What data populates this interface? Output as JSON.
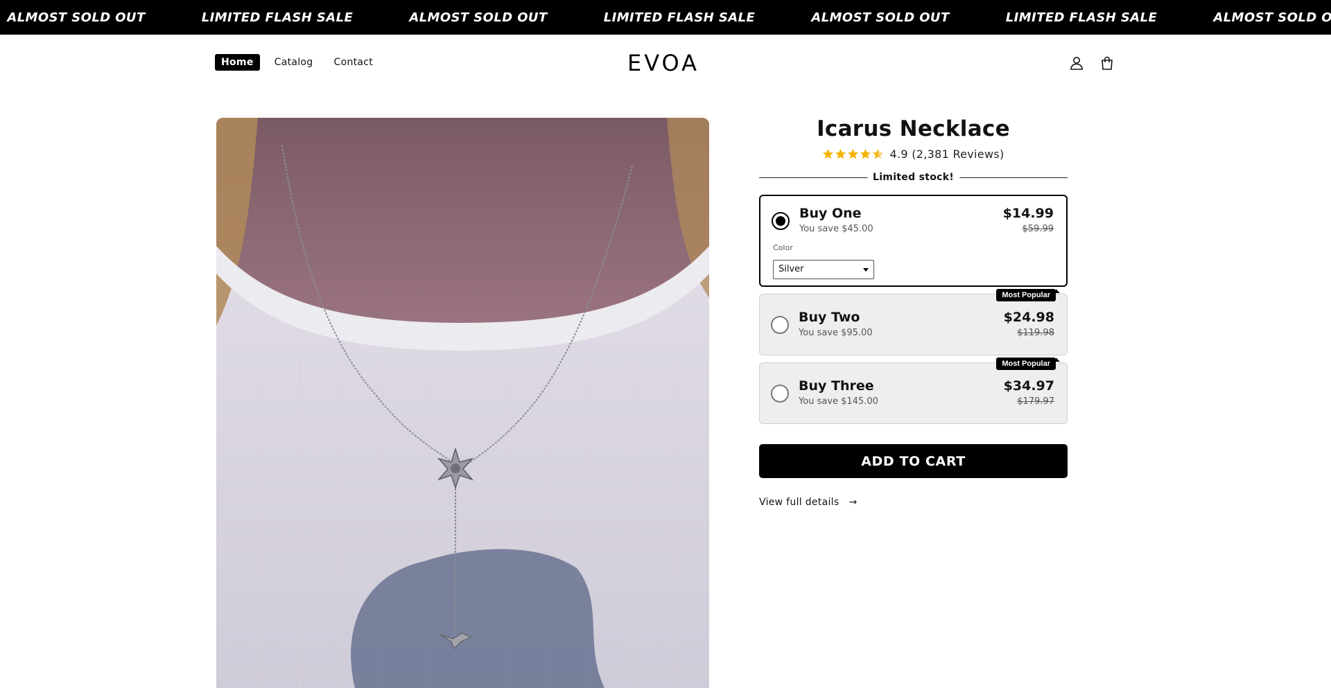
{
  "banner": {
    "items": [
      "ALMOST SOLD OUT",
      "LIMITED FLASH SALE",
      "ALMOST SOLD OUT",
      "LIMITED FLASH SALE",
      "ALMOST SOLD OUT",
      "LIMITED FLASH SALE",
      "ALMOST SOLD OUT"
    ]
  },
  "header": {
    "nav": [
      {
        "label": "Home",
        "active": true
      },
      {
        "label": "Catalog",
        "active": false
      },
      {
        "label": "Contact",
        "active": false
      }
    ],
    "logo": "EVOA",
    "icons": [
      "account-icon",
      "cart-icon"
    ]
  },
  "product": {
    "title": "Icarus Necklace",
    "rating": {
      "value": 4.9,
      "stars": 4.5,
      "text": "4.9 (2,381 Reviews)"
    },
    "stock_label": "Limited stock!",
    "options": [
      {
        "title": "Buy One",
        "save": "You save $45.00",
        "price": "$14.99",
        "compare": "$59.99",
        "selected": true,
        "badge": null
      },
      {
        "title": "Buy Two",
        "save": "You save $95.00",
        "price": "$24.98",
        "compare": "$119.98",
        "selected": false,
        "badge": "Most Popular"
      },
      {
        "title": "Buy Three",
        "save": "You save $145.00",
        "price": "$34.97",
        "compare": "$179.97",
        "selected": false,
        "badge": "Most Popular"
      }
    ],
    "color": {
      "label": "Color",
      "selected": "Silver"
    },
    "add_to_cart": "ADD TO CART",
    "details_link": "View full details",
    "colors": {
      "accent": "#000000",
      "star": "#f5b301",
      "option_bg": "#eeeeee"
    }
  }
}
